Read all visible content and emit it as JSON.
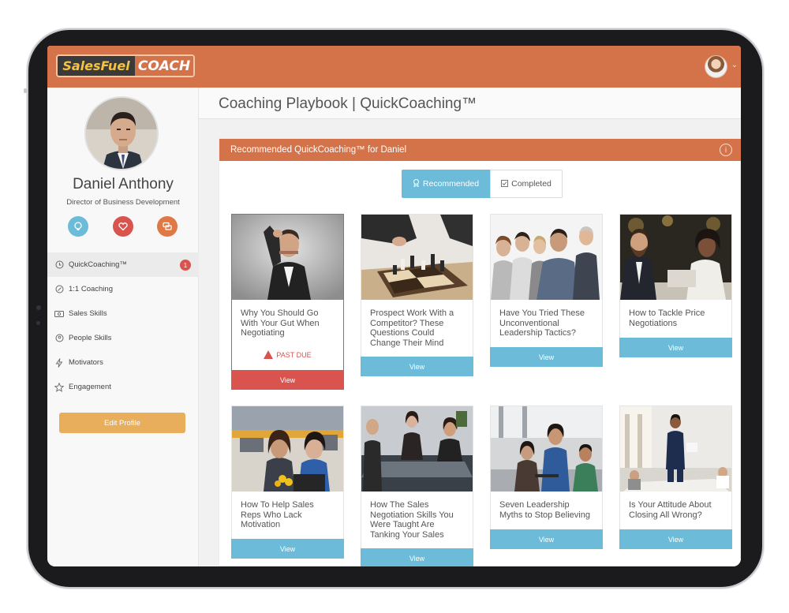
{
  "app": {
    "logo_part1": "SalesFuel",
    "logo_part2": "COACH"
  },
  "header": {
    "page_title": "Coaching Playbook | QuickCoaching™"
  },
  "profile": {
    "name": "Daniel Anthony",
    "role": "Director of Business Development",
    "action_icons": [
      "lightbulb-icon",
      "heart-icon",
      "chat-icon"
    ],
    "action_colors": [
      "#6cbbd9",
      "#d9534f",
      "#e07845"
    ]
  },
  "sidebar": {
    "items": [
      {
        "label": "QuickCoaching™",
        "icon": "quickcoaching-icon",
        "badge": "1",
        "active": true
      },
      {
        "label": "1:1 Coaching",
        "icon": "coaching-icon"
      },
      {
        "label": "Sales Skills",
        "icon": "sales-skills-icon"
      },
      {
        "label": "People Skills",
        "icon": "people-skills-icon"
      },
      {
        "label": "Motivators",
        "icon": "bolt-icon"
      },
      {
        "label": "Engagement",
        "icon": "star-icon"
      }
    ],
    "edit_profile": "Edit Profile"
  },
  "panel": {
    "title": "Recommended QuickCoaching™ for Daniel",
    "tabs": [
      {
        "label": "Recommended",
        "selected": true
      },
      {
        "label": "Completed",
        "selected": false
      }
    ]
  },
  "cards": [
    {
      "title": "Why You Should Go With Your Gut When Negotiating",
      "status": "PAST DUE",
      "button": "View"
    },
    {
      "title": "Prospect Work With a Competitor? These Questions Could Change Their Mind",
      "button": "View"
    },
    {
      "title": "Have You Tried These Unconventional Leadership Tactics?",
      "button": "View"
    },
    {
      "title": "How to Tackle Price Negotiations",
      "button": "View"
    },
    {
      "title": "How To Help Sales Reps Who Lack Motivation",
      "button": "View"
    },
    {
      "title": "How The Sales Negotiation Skills You Were Taught Are Tanking Your Sales",
      "button": "View"
    },
    {
      "title": "Seven Leadership Myths to Stop Believing",
      "button": "View"
    },
    {
      "title": "Is Your Attitude About Closing All Wrong?",
      "button": "View"
    }
  ],
  "colors": {
    "brand_orange": "#d4734a",
    "accent_blue": "#6cbbd9",
    "alert_red": "#d9534f",
    "button_gold": "#e9ae5b"
  }
}
